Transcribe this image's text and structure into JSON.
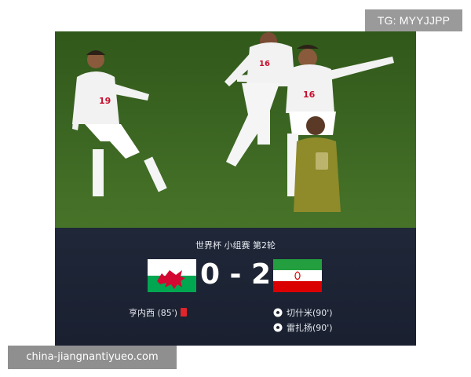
{
  "top_badge": "TG: MYYJJPP",
  "photo": {
    "players": [
      {
        "number": "19"
      },
      {
        "number": "16"
      },
      {
        "number": "16"
      }
    ]
  },
  "match": {
    "competition": "世界杯 小组赛 第2轮",
    "home_team_flag": "wales-flag",
    "away_team_flag": "iran-flag",
    "score": "0 - 2",
    "home_events": [
      {
        "text": "亨内西 (85')",
        "icon": "red-card-icon"
      }
    ],
    "away_events": [
      {
        "text": "切什米(90')",
        "icon": "soccer-ball-icon"
      },
      {
        "text": "雷扎扬(90')",
        "icon": "soccer-ball-icon"
      }
    ]
  },
  "watermark": "china-jiangnantiyueo.com",
  "colors": {
    "panel": "#1e2435",
    "pitch": "#3f6d24",
    "red_card": "#e0252c",
    "iran_green": "#239f40",
    "iran_red": "#da0000",
    "wales_green": "#00a650",
    "wales_red": "#d30731"
  }
}
